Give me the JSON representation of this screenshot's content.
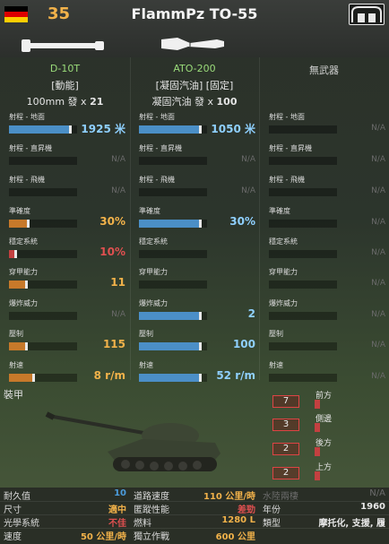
{
  "header": {
    "price": "35",
    "title": "FlammPz TO-55",
    "flag_colors": [
      "#000000",
      "#dd0000",
      "#ffce00"
    ]
  },
  "weapons": [
    {
      "name": "D-10T",
      "tag": "[動能]",
      "ammo_prefix": "100mm 發 x",
      "ammo_count": "21"
    },
    {
      "name": "ATO-200",
      "tag": "[凝固汽油] [固定]",
      "ammo_prefix": "凝固汽油 發 x",
      "ammo_count": "100"
    },
    {
      "name": "無武器",
      "tag": "",
      "ammo_prefix": "",
      "ammo_count": ""
    }
  ],
  "stat_labels": [
    "射程 - 地面",
    "射程 - 直昇機",
    "射程 - 飛機",
    "準確度",
    "穩定系統",
    "穿甲能力",
    "爆炸威力",
    "壓制",
    "射速"
  ],
  "stats": [
    [
      {
        "value": "1925 米",
        "fill": 0.92,
        "color": "blue"
      },
      {
        "value": "N/A",
        "fill": 0,
        "color": "none"
      },
      {
        "value": "N/A",
        "fill": 0,
        "color": "none"
      },
      {
        "value": "30%",
        "fill": 0.3,
        "color": "orange"
      },
      {
        "value": "10%",
        "fill": 0.12,
        "color": "red"
      },
      {
        "value": "11",
        "fill": 0.28,
        "color": "orange"
      },
      {
        "value": "N/A",
        "fill": 0,
        "color": "none"
      },
      {
        "value": "115",
        "fill": 0.28,
        "color": "orange"
      },
      {
        "value": "8 r/m",
        "fill": 0.38,
        "color": "orange"
      }
    ],
    [
      {
        "value": "1050 米",
        "fill": 0.92,
        "color": "blue"
      },
      {
        "value": "N/A",
        "fill": 0,
        "color": "none"
      },
      {
        "value": "N/A",
        "fill": 0,
        "color": "none"
      },
      {
        "value": "30%",
        "fill": 0.92,
        "color": "blue"
      },
      {
        "value": "",
        "fill": 0,
        "color": "none"
      },
      {
        "value": "",
        "fill": 0,
        "color": "none"
      },
      {
        "value": "2",
        "fill": 0.92,
        "color": "blue"
      },
      {
        "value": "100",
        "fill": 0.92,
        "color": "blue"
      },
      {
        "value": "52 r/m",
        "fill": 0.92,
        "color": "blue"
      }
    ],
    [
      {
        "value": "N/A",
        "fill": 0,
        "color": "none"
      },
      {
        "value": "N/A",
        "fill": 0,
        "color": "none"
      },
      {
        "value": "N/A",
        "fill": 0,
        "color": "none"
      },
      {
        "value": "N/A",
        "fill": 0,
        "color": "none"
      },
      {
        "value": "N/A",
        "fill": 0,
        "color": "none"
      },
      {
        "value": "N/A",
        "fill": 0,
        "color": "none"
      },
      {
        "value": "N/A",
        "fill": 0,
        "color": "none"
      },
      {
        "value": "N/A",
        "fill": 0,
        "color": "none"
      },
      {
        "value": "N/A",
        "fill": 0,
        "color": "none"
      }
    ]
  ],
  "armor": {
    "title": "裝甲",
    "values": [
      {
        "label": "前方",
        "value": "7"
      },
      {
        "label": "側邊",
        "value": "3"
      },
      {
        "label": "後方",
        "value": "2"
      },
      {
        "label": "上方",
        "value": "2"
      }
    ]
  },
  "specs": [
    {
      "key": "耐久值",
      "value": "10",
      "color": "#4b9cdc"
    },
    {
      "key": "道路速度",
      "value": "110 公里/時",
      "color": "#f2b24a"
    },
    {
      "key": "水陸兩棲",
      "value": "N/A",
      "color": "#6c6c6c"
    },
    {
      "key": "尺寸",
      "value": "適中",
      "color": "#f2b24a"
    },
    {
      "key": "匿蹤性能",
      "value": "差勁",
      "color": "#e05050"
    },
    {
      "key": "年份",
      "value": "1960",
      "color": "#e8e8e8"
    },
    {
      "key": "光學系統",
      "value": "不佳",
      "color": "#e05050"
    },
    {
      "key": "燃料",
      "value": "1280 L",
      "color": "#f2b24a"
    },
    {
      "key": "類型",
      "value": "摩托化, 支援, 履",
      "color": "#e8e8e8"
    },
    {
      "key": "速度",
      "value": "50 公里/時",
      "color": "#f2b24a"
    },
    {
      "key": "獨立作戰",
      "value": "600 公里",
      "color": "#f2b24a"
    }
  ]
}
